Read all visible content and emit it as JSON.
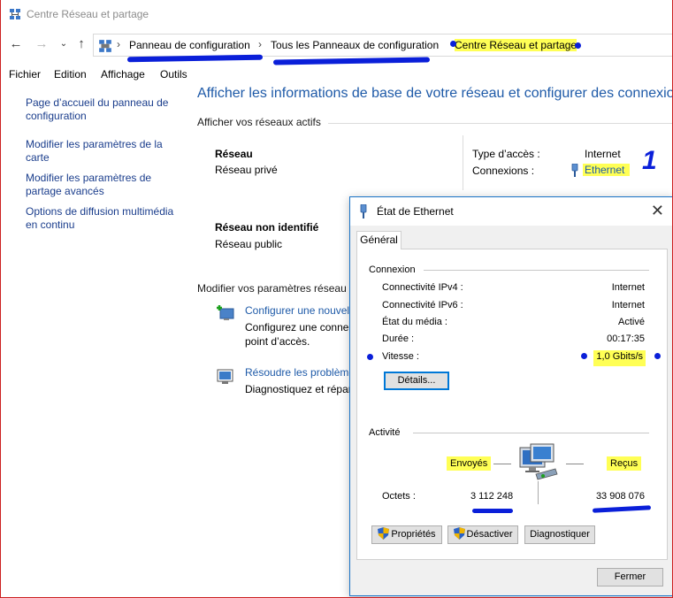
{
  "window": {
    "title": "Centre Réseau et partage"
  },
  "nav": {
    "back_icon": "arrow-left-icon",
    "forward_icon": "arrow-right-icon",
    "recent_icon": "chevron-down-icon",
    "up_icon": "arrow-up-icon"
  },
  "breadcrumb": [
    "Panneau de configuration",
    "Tous les Panneaux de configuration",
    "Centre Réseau et partage"
  ],
  "menu": [
    "Fichier",
    "Edition",
    "Affichage",
    "Outils"
  ],
  "sidebar": [
    "Page d’accueil du panneau de configuration",
    "Modifier les paramètres de la carte",
    "Modifier les paramètres de partage avancés",
    "Options de diffusion multimédia en continu"
  ],
  "main": {
    "heading": "Afficher les informations de base de votre réseau et configurer des connexions",
    "active_networks_label": "Afficher vos réseaux actifs",
    "net1": {
      "name": "Réseau",
      "type": "Réseau privé",
      "access_label": "Type d’accès :",
      "access_value": "Internet",
      "connections_label": "Connexions :",
      "connections_value": "Ethernet"
    },
    "net2": {
      "name": "Réseau non identifié",
      "type": "Réseau public"
    },
    "annotation_number": "1",
    "change_settings_label": "Modifier vos paramètres réseau",
    "task1": {
      "link": "Configurer une nouvel",
      "desc1": "Configurez une conne",
      "desc2": "point d’accès."
    },
    "task2": {
      "link": "Résoudre les problème",
      "desc1": "Diagnostiquez et répar"
    }
  },
  "dialog": {
    "title": "État de Ethernet",
    "tab": "Général",
    "connection_group": "Connexion",
    "rows": [
      {
        "label": "Connectivité IPv4 :",
        "value": "Internet"
      },
      {
        "label": "Connectivité IPv6 :",
        "value": "Internet"
      },
      {
        "label": "État du média :",
        "value": "Activé"
      },
      {
        "label": "Durée :",
        "value": "00:17:35"
      },
      {
        "label": "Vitesse :",
        "value": "1,0 Gbits/s"
      }
    ],
    "details_button": "Détails...",
    "activity_group": "Activité",
    "sent_label": "Envoyés",
    "received_label": "Reçus",
    "bytes_label": "Octets :",
    "bytes_sent": "3 112 248",
    "bytes_received": "33 908 076",
    "properties_button": "Propriétés",
    "disable_button": "Désactiver",
    "diagnose_button": "Diagnostiquer",
    "close_button": "Fermer"
  },
  "colors": {
    "link": "#1e5aa8",
    "highlight": "#ffff55",
    "annotation": "#0a1fd9",
    "dialog_border": "#1a73c7"
  }
}
